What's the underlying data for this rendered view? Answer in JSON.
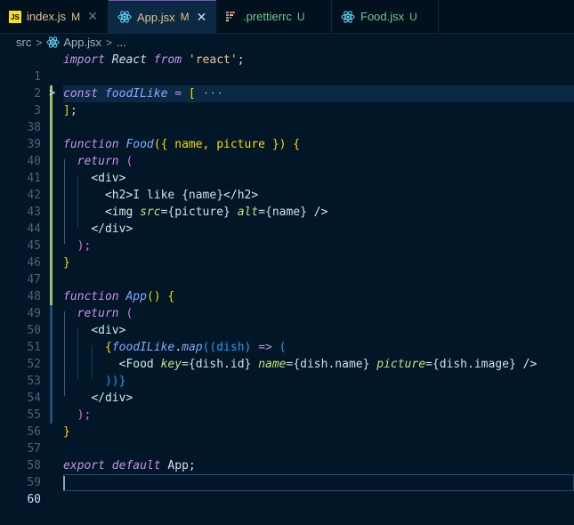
{
  "tabs": [
    {
      "label": "index.js",
      "status": "M",
      "icon": "js-file-icon",
      "active": false,
      "show_close": true
    },
    {
      "label": "App.jsx",
      "status": "M",
      "icon": "react-icon",
      "active": true,
      "show_close": true
    },
    {
      "label": ".prettierrc",
      "status": "U",
      "icon": "prettier-icon",
      "active": false,
      "show_close": false
    },
    {
      "label": "Food.jsx",
      "status": "U",
      "icon": "react-icon",
      "active": false,
      "show_close": false
    }
  ],
  "breadcrumb": {
    "folder": "src",
    "file": "App.jsx",
    "more": "..."
  },
  "line_numbers": [
    "1",
    "2",
    "3",
    "38",
    "39",
    "40",
    "41",
    "42",
    "43",
    "44",
    "45",
    "46",
    "47",
    "48",
    "49",
    "50",
    "51",
    "52",
    "53",
    "54",
    "55",
    "56",
    "57",
    "58",
    "59",
    "60"
  ],
  "code": {
    "l1": {
      "import": "import",
      "react": "React",
      "from": "from",
      "str": "'react'",
      "semi": ";"
    },
    "l3": {
      "const": "const",
      "name": "foodILike",
      "eq": "=",
      "open": "[",
      "ellipsis": "···"
    },
    "l38": {
      "close": "]",
      "semi": ";"
    },
    "l40": {
      "function": "function",
      "name": "Food",
      "params": "({ name, picture }) {"
    },
    "l41": {
      "return": "return",
      "paren": "("
    },
    "l42": {
      "tag": "<div>"
    },
    "l43": {
      "open": "<h2>",
      "text": "I like ",
      "expr": "{name}",
      "close": "</h2>"
    },
    "l44": {
      "tag_open": "<img",
      "src_attr": "src",
      "src_val": "={picture}",
      "alt_attr": "alt",
      "alt_val": "={name}",
      "tag_close": " />"
    },
    "l45": {
      "tag": "</div>"
    },
    "l46": {
      "paren": ");"
    },
    "l47": {
      "brace": "}"
    },
    "l49": {
      "function": "function",
      "name": "App",
      "rest": "() {"
    },
    "l50": {
      "return": "return",
      "paren": "("
    },
    "l51": {
      "tag": "<div>"
    },
    "l52": {
      "open": "{",
      "obj": "foodILike",
      "dot": ".",
      "method": "map",
      "args": "((dish)",
      "arrow": "=>",
      "paren": "("
    },
    "l53": {
      "tag_open": "<Food",
      "key_attr": "key",
      "key_val": "={dish.id}",
      "name_attr": "name",
      "name_val": "={dish.name}",
      "pic_attr": "picture",
      "pic_val": "={dish.image}",
      "tag_close": " />"
    },
    "l54": {
      "text": "))}"
    },
    "l55": {
      "tag": "</div>"
    },
    "l56": {
      "paren": ");"
    },
    "l57": {
      "brace": "}"
    },
    "l59": {
      "export": "export",
      "default": "default",
      "name": "App",
      "semi": ";"
    }
  },
  "colors": {
    "background": "#011627",
    "accent": "#7e57c2",
    "modified": "#e2c08d",
    "untracked": "#73c991"
  }
}
